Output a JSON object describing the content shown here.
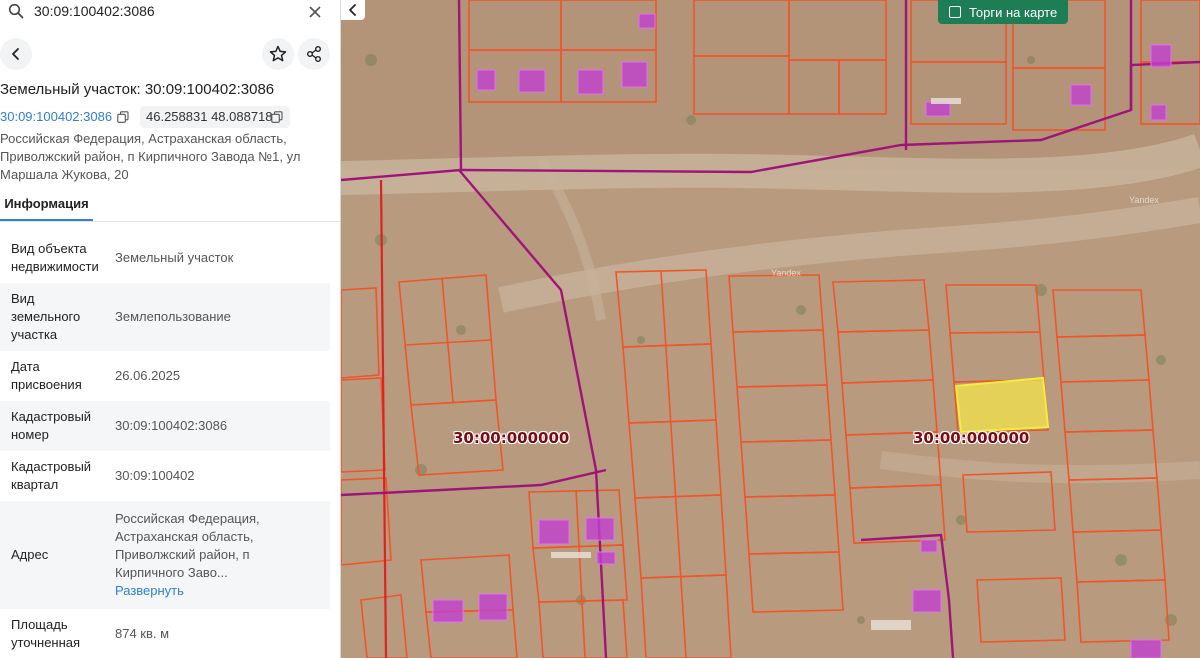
{
  "search": {
    "value": "30:09:100402:3086",
    "icon": "search-icon",
    "clear_icon": "close-icon"
  },
  "toolbar": {
    "back_icon": "chevron-left-icon",
    "favorite_icon": "star-icon",
    "share_icon": "share-icon"
  },
  "object": {
    "title": "Земельный участок: 30:09:100402:3086",
    "cadastral_link": "30:09:100402:3086",
    "coordinates": "46.258831 48.088718",
    "address": "Российская Федерация, Астраханская область, Приволжский район, п Кирпичного Завода №1, ул Маршала Жукова, 20"
  },
  "tabs": [
    {
      "label": "Информация",
      "active": true
    }
  ],
  "info_rows": [
    {
      "key": "Вид объекта недвижимости",
      "value": "Земельный участок"
    },
    {
      "key": "Вид земельного участка",
      "value": "Землепользование"
    },
    {
      "key": "Дата присвоения",
      "value": "26.06.2025"
    },
    {
      "key": "Кадастровый номер",
      "value": "30:09:100402:3086"
    },
    {
      "key": "Кадастровый квартал",
      "value": "30:09:100402"
    },
    {
      "key": "Адрес",
      "value": "Российская Федерация, Астраханская область, Приволжский район, п Кирпичного Заво...",
      "action": "Развернуть"
    },
    {
      "key": "Площадь уточненная",
      "value": "874 кв. м"
    }
  ],
  "map": {
    "auction_toggle_label": "Торги на карте",
    "auction_toggle_checked": false,
    "collapse_icon": "chevron-left-icon",
    "quarter_labels": [
      "30:00:000000",
      "30:00:000000"
    ],
    "watermarks": [
      "Yandex",
      "Yandex"
    ],
    "colors": {
      "parcel_border": "#f0552a",
      "district_border": "#a0147a",
      "zone_border": "#dd2222",
      "building_fill": "#c040d0",
      "selected_fill": "#f2e44a",
      "accent_green": "#1d7d54",
      "link_blue": "#2f7fd6"
    }
  }
}
